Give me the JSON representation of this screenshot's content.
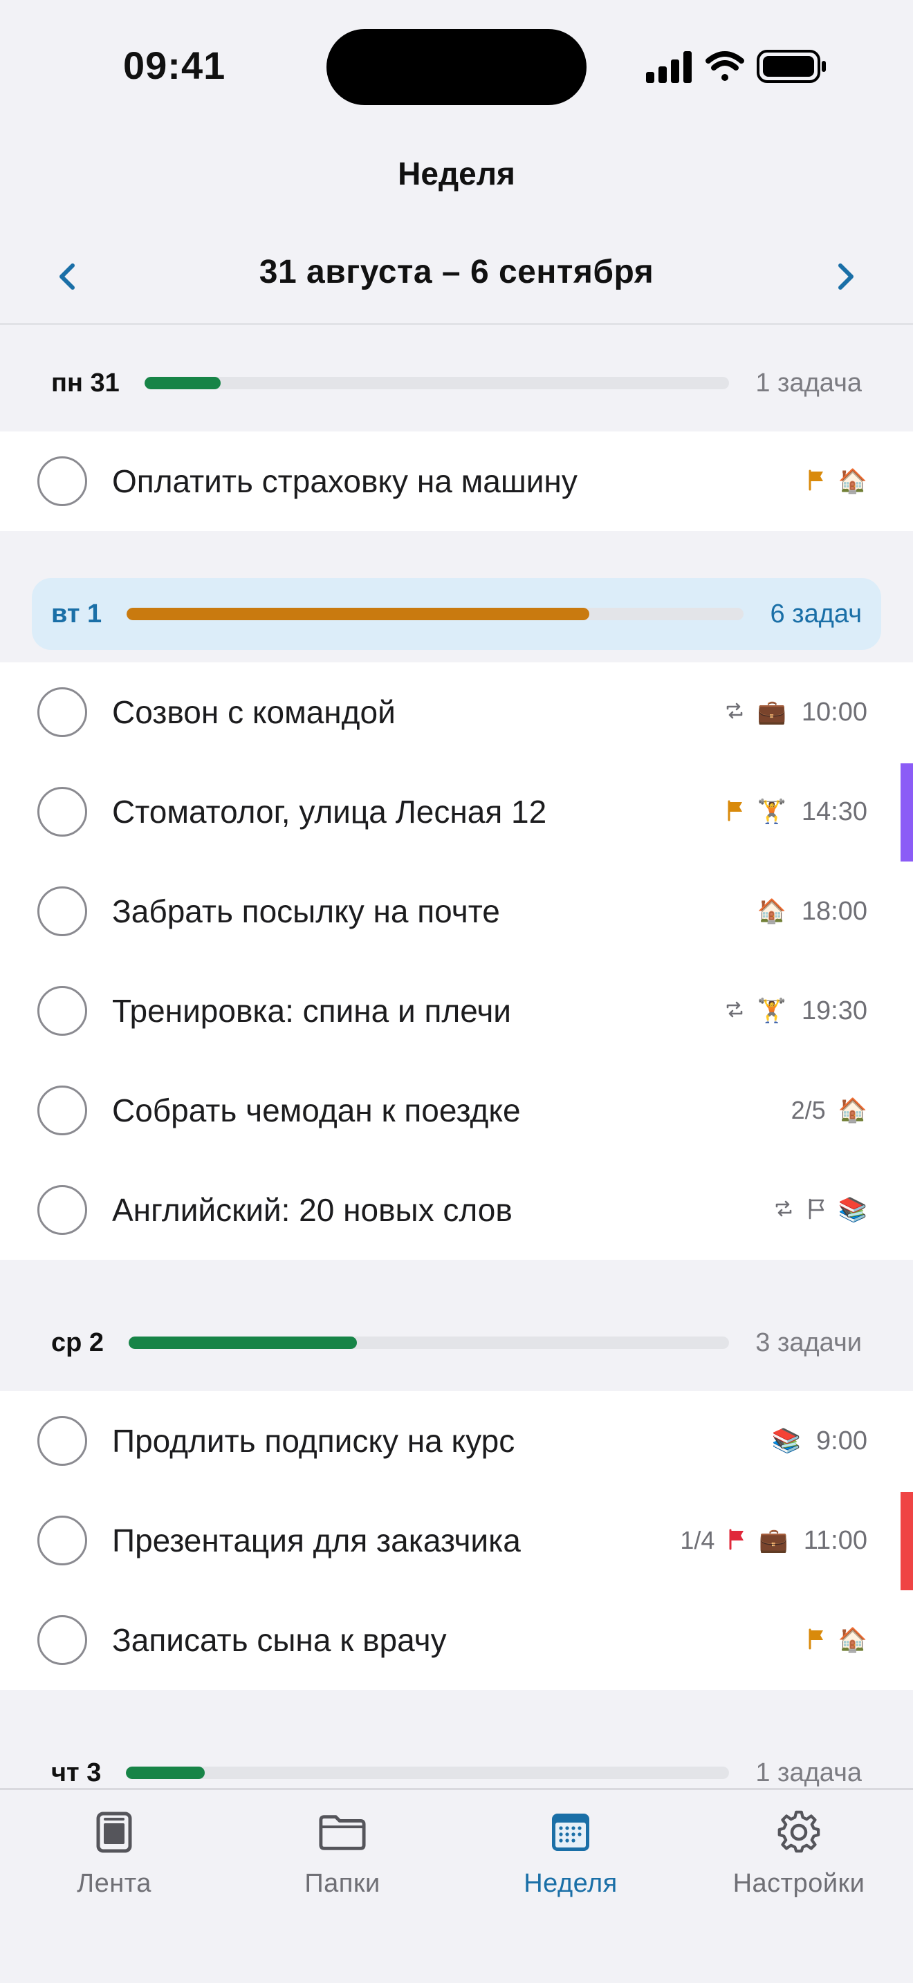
{
  "status_bar": {
    "time": "09:41"
  },
  "header": {
    "title": "Неделя"
  },
  "week": {
    "range": "31 августа – 6 сентября"
  },
  "colors": {
    "accent": "#1a6fa7",
    "progress_green": "#178447",
    "progress_orange": "#c97a0f",
    "flag_orange": "#d98a0b",
    "flag_red": "#e0283a",
    "edge_purple": "#8b5cf6",
    "edge_red": "#ef4444"
  },
  "days": [
    {
      "label": "пн 31",
      "count": "1 задача",
      "progress": 0.13,
      "bar_color": "#178447",
      "current": false,
      "tasks": [
        {
          "title": "Оплатить страховку на машину",
          "meta": [
            {
              "kind": "flag",
              "color": "#d98a0b"
            },
            {
              "kind": "emoji",
              "value": "🏠",
              "icon": "house-icon"
            }
          ]
        }
      ]
    },
    {
      "label": "вт 1",
      "count": "6 задач",
      "progress": 0.75,
      "bar_color": "#c97a0f",
      "current": true,
      "tasks": [
        {
          "title": "Созвон с командой",
          "meta": [
            {
              "kind": "repeat"
            },
            {
              "kind": "emoji",
              "value": "💼",
              "icon": "briefcase-icon"
            },
            {
              "kind": "time",
              "value": "10:00"
            }
          ]
        },
        {
          "title": "Стоматолог, улица Лесная 12",
          "edge": "#8b5cf6",
          "meta": [
            {
              "kind": "flag",
              "color": "#d98a0b"
            },
            {
              "kind": "emoji",
              "value": "🏋️",
              "icon": "weightlifter-icon"
            },
            {
              "kind": "time",
              "value": "14:30"
            }
          ]
        },
        {
          "title": "Забрать посылку на почте",
          "meta": [
            {
              "kind": "emoji",
              "value": "🏠",
              "icon": "house-icon"
            },
            {
              "kind": "time",
              "value": "18:00"
            }
          ]
        },
        {
          "title": "Тренировка: спина и плечи",
          "meta": [
            {
              "kind": "repeat"
            },
            {
              "kind": "emoji",
              "value": "🏋️",
              "icon": "weightlifter-icon"
            },
            {
              "kind": "time",
              "value": "19:30"
            }
          ]
        },
        {
          "title": "Собрать чемодан к поездке",
          "meta": [
            {
              "kind": "sub",
              "value": "2/5"
            },
            {
              "kind": "emoji",
              "value": "🏠",
              "icon": "house-icon"
            }
          ]
        },
        {
          "title": "Английский: 20 новых слов",
          "meta": [
            {
              "kind": "repeat"
            },
            {
              "kind": "flag-outline"
            },
            {
              "kind": "emoji",
              "value": "📚",
              "icon": "books-icon"
            }
          ]
        }
      ]
    },
    {
      "label": "ср 2",
      "count": "3 задачи",
      "progress": 0.38,
      "bar_color": "#178447",
      "current": false,
      "tasks": [
        {
          "title": "Продлить подписку на курс",
          "meta": [
            {
              "kind": "emoji",
              "value": "📚",
              "icon": "books-icon"
            },
            {
              "kind": "time",
              "value": "9:00"
            }
          ]
        },
        {
          "title": "Презентация для заказчика",
          "edge": "#ef4444",
          "meta": [
            {
              "kind": "sub",
              "value": "1/4"
            },
            {
              "kind": "flag",
              "color": "#e0283a"
            },
            {
              "kind": "emoji",
              "value": "💼",
              "icon": "briefcase-icon"
            },
            {
              "kind": "time",
              "value": "11:00"
            }
          ]
        },
        {
          "title": "Записать сына к врачу",
          "meta": [
            {
              "kind": "flag",
              "color": "#d98a0b"
            },
            {
              "kind": "emoji",
              "value": "🏠",
              "icon": "house-icon"
            }
          ]
        }
      ]
    },
    {
      "label": "чт 3",
      "count": "1 задача",
      "progress": 0.13,
      "bar_color": "#178447",
      "current": false,
      "tasks": []
    }
  ],
  "tabs": [
    {
      "label": "Лента",
      "icon": "feed-icon",
      "active": false
    },
    {
      "label": "Папки",
      "icon": "folder-icon",
      "active": false
    },
    {
      "label": "Неделя",
      "icon": "calendar-icon",
      "active": true
    },
    {
      "label": "Настройки",
      "icon": "gear-icon",
      "active": false
    }
  ]
}
